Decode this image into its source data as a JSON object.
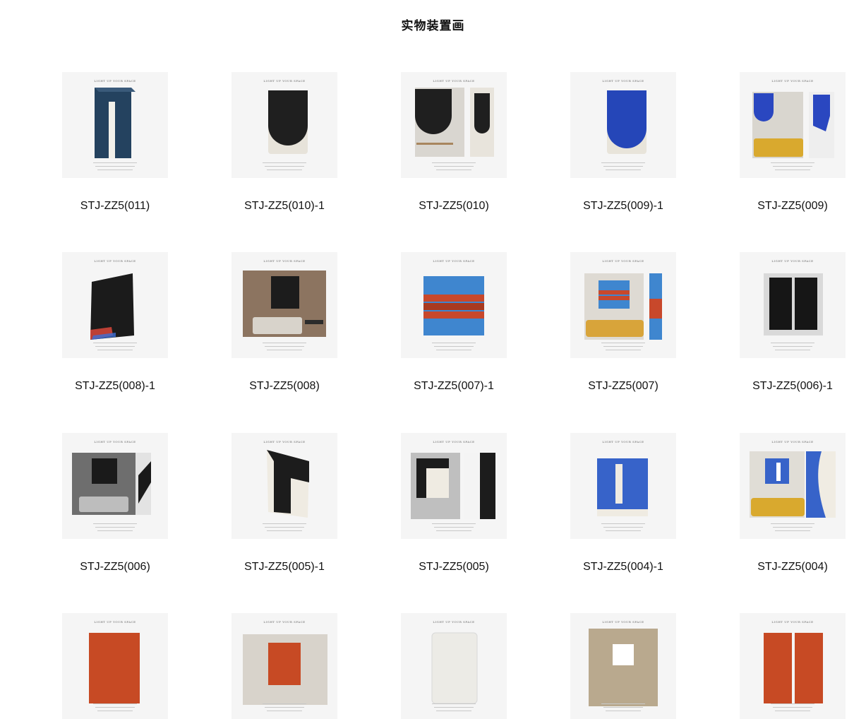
{
  "header": {
    "title": "实物装置画"
  },
  "products": [
    {
      "code": "STJ-ZZ5(011)",
      "brand_text": "LIGHT UP YOUR SPACE",
      "artwork": "navy-vertical-fold-panel",
      "palette": [
        "#24425f",
        "#f2f0ea"
      ]
    },
    {
      "code": "STJ-ZZ5(010)-1",
      "brand_text": "LIGHT UP YOUR SPACE",
      "artwork": "black-arch-fold-panel",
      "palette": [
        "#1f1f1f",
        "#e7e3da"
      ]
    },
    {
      "code": "STJ-ZZ5(010)",
      "brand_text": "LIGHT UP YOUR SPACE",
      "artwork": "room-scene-black-arch",
      "palette": [
        "#1f1f1f",
        "#e8e4dc",
        "#a8865f"
      ]
    },
    {
      "code": "STJ-ZZ5(009)-1",
      "brand_text": "LIGHT UP YOUR SPACE",
      "artwork": "blue-arch-fold-panel",
      "palette": [
        "#2546b8",
        "#e8e4da"
      ]
    },
    {
      "code": "STJ-ZZ5(009)",
      "brand_text": "LIGHT UP YOUR SPACE",
      "artwork": "room-scene-blue-arch-sofa",
      "palette": [
        "#2a47c0",
        "#d9a92e",
        "#d9d6cf"
      ]
    },
    {
      "code": "STJ-ZZ5(008)-1",
      "brand_text": "LIGHT UP YOUR SPACE",
      "artwork": "black-wave-fold-panel",
      "palette": [
        "#1b1b1b",
        "#e64a3c",
        "#3b6fd8"
      ]
    },
    {
      "code": "STJ-ZZ5(008)",
      "brand_text": "LIGHT UP YOUR SPACE",
      "artwork": "room-scene-living-room",
      "palette": [
        "#8c7460",
        "#d8d3cb",
        "#1c1c1c"
      ]
    },
    {
      "code": "STJ-ZZ5(007)-1",
      "brand_text": "LIGHT UP YOUR SPACE",
      "artwork": "blue-red-fold-panel",
      "palette": [
        "#3f86cf",
        "#c8482b"
      ]
    },
    {
      "code": "STJ-ZZ5(007)",
      "brand_text": "LIGHT UP YOUR SPACE",
      "artwork": "room-scene-blue-red-sofa",
      "palette": [
        "#3f86cf",
        "#c8482b",
        "#d8a43a"
      ]
    },
    {
      "code": "STJ-ZZ5(006)-1",
      "brand_text": "LIGHT UP YOUR SPACE",
      "artwork": "black-split-fold-panel",
      "palette": [
        "#161616",
        "#d9d9d9"
      ]
    },
    {
      "code": "STJ-ZZ5(006)",
      "brand_text": "LIGHT UP YOUR SPACE",
      "artwork": "room-scene-grey-interior",
      "palette": [
        "#6e6e6e",
        "#1a1a1a",
        "#e3e3e3"
      ]
    },
    {
      "code": "STJ-ZZ5(005)-1",
      "brand_text": "LIGHT UP YOUR SPACE",
      "artwork": "black-cream-fold-panel",
      "palette": [
        "#1c1c1c",
        "#efebe2"
      ]
    },
    {
      "code": "STJ-ZZ5(005)",
      "brand_text": "LIGHT UP YOUR SPACE",
      "artwork": "room-scene-black-cream",
      "palette": [
        "#1c1c1c",
        "#efebe2",
        "#c9a36a"
      ]
    },
    {
      "code": "STJ-ZZ5(004)-1",
      "brand_text": "LIGHT UP YOUR SPACE",
      "artwork": "blue-notch-fold-panel",
      "palette": [
        "#3763c9",
        "#efebe2"
      ]
    },
    {
      "code": "STJ-ZZ5(004)",
      "brand_text": "LIGHT UP YOUR SPACE",
      "artwork": "room-scene-blue-sofa",
      "palette": [
        "#3763c9",
        "#d9a92e",
        "#e0ddd6"
      ]
    },
    {
      "code": "",
      "brand_text": "LIGHT UP YOUR SPACE",
      "artwork": "orange-fold-panel",
      "palette": [
        "#c74a24"
      ]
    },
    {
      "code": "",
      "brand_text": "LIGHT UP YOUR SPACE",
      "artwork": "room-scene-orange",
      "palette": [
        "#c74a24",
        "#d8d3cb"
      ]
    },
    {
      "code": "",
      "brand_text": "LIGHT UP YOUR SPACE",
      "artwork": "white-fold-panel",
      "palette": [
        "#ecebe6"
      ]
    },
    {
      "code": "",
      "brand_text": "LIGHT UP YOUR SPACE",
      "artwork": "room-scene-beige",
      "palette": [
        "#b9a98e",
        "#ffffff"
      ]
    },
    {
      "code": "",
      "brand_text": "LIGHT UP YOUR SPACE",
      "artwork": "orange-split-panel",
      "palette": [
        "#c74a24"
      ]
    }
  ]
}
